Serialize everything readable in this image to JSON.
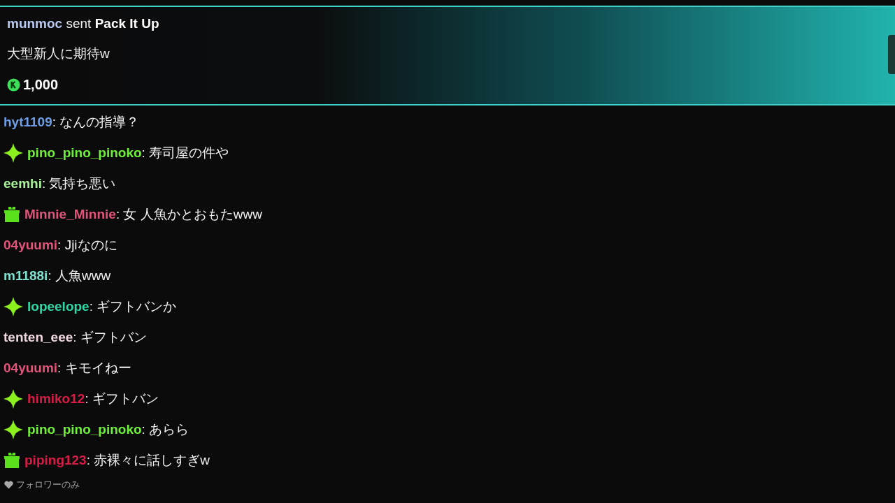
{
  "gift_banner": {
    "sender": "munmoc",
    "action": "sent",
    "gift": "Pack It Up",
    "message": "大型新人に期待w",
    "amount": "1,000"
  },
  "messages": [
    {
      "user": "hyt1109",
      "color": "#6f9ee6",
      "text": ": なんの指導？"
    },
    {
      "kind": "diamond",
      "user": "pino_pino_pinoko",
      "color": "#6ff03a",
      "text": ": 寿司屋の件や"
    },
    {
      "user": "eemhi",
      "color": "#a9f09a",
      "text": ": 気持ち悪い"
    },
    {
      "kind": "gift",
      "user": "Minnie_Minnie",
      "color": "#e0557a",
      "text": ": 女 人魚かとおもたwww"
    },
    {
      "user": "04yuumi",
      "color": "#e0557a",
      "text": ": Jjiなのに"
    },
    {
      "user": "m1188i",
      "color": "#7fe0d0",
      "text": ": 人魚www"
    },
    {
      "kind": "diamond",
      "user": "lopeelope",
      "color": "#2fd6a6",
      "text": ": ギフトバンか"
    },
    {
      "user": "tenten_eee",
      "color": "#f0d8e0",
      "text": ": ギフトバン"
    },
    {
      "user": "04yuumi",
      "color": "#e0557a",
      "text": ": キモイねー"
    },
    {
      "kind": "diamond",
      "user": "himiko12",
      "color": "#d81c48",
      "text": ": ギフトバン"
    },
    {
      "kind": "diamond",
      "user": "pino_pino_pinoko",
      "color": "#6ff03a",
      "text": ": あらら"
    },
    {
      "kind": "gift",
      "user": "piping123",
      "color": "#d81c48",
      "text": ": 赤裸々に話しすぎw"
    }
  ],
  "chat_mode": "フォロワーのみ"
}
